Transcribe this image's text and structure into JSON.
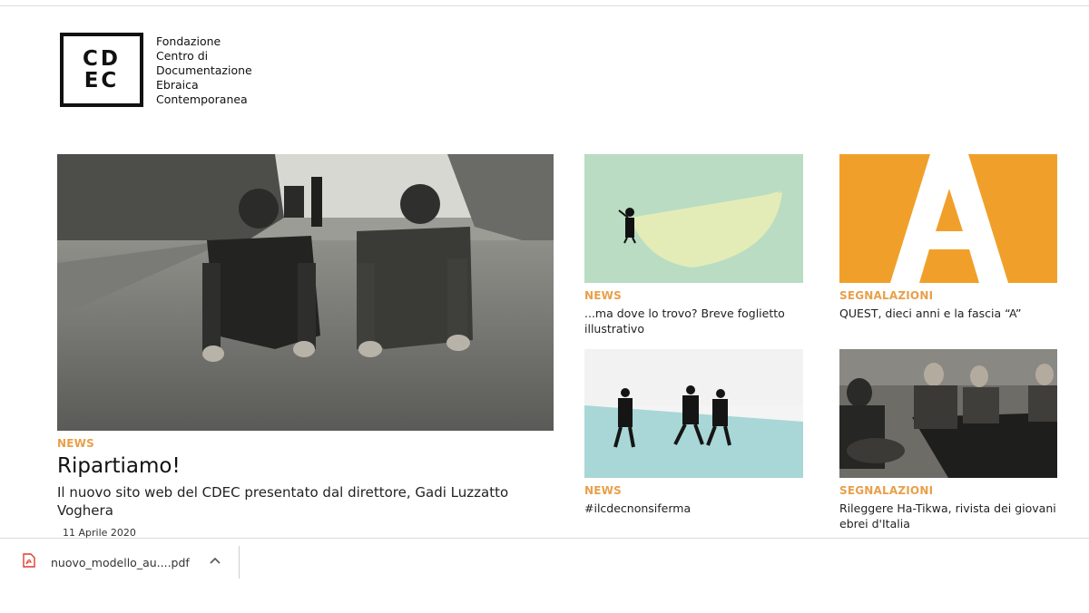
{
  "logo": {
    "line1": "CD",
    "line2": "EC"
  },
  "org_name": [
    "Fondazione",
    "Centro di",
    "Documentazione",
    "Ebraica",
    "Contemporanea"
  ],
  "featured": {
    "category": "NEWS",
    "title": "Ripartiamo!",
    "description": "Il nuovo sito web del CDEC presentato dal direttore, Gadi Luzzatto Voghera",
    "date": "11 Aprile 2020"
  },
  "cards": [
    {
      "category": "NEWS",
      "title": "...ma dove lo trovo? Breve foglietto illustrativo"
    },
    {
      "category": "SEGNALAZIONI",
      "title": "QUEST, dieci anni e la fascia “A”"
    },
    {
      "category": "NEWS",
      "title": "#ilcdecnonsiferma"
    },
    {
      "category": "SEGNALAZIONI",
      "title": "Rileggere Ha-Tikwa, rivista dei giovani ebrei d'Italia"
    }
  ],
  "download_bar": {
    "filename": "nuovo_modello_au....pdf"
  },
  "colors": {
    "accent": "#e8a04a",
    "orange_tile": "#f0a02a",
    "mint_tile": "#b9dcc3",
    "sea_tile": "#a9d6d6"
  },
  "icons": [
    "pdf-file-icon",
    "chevron-up-icon"
  ]
}
